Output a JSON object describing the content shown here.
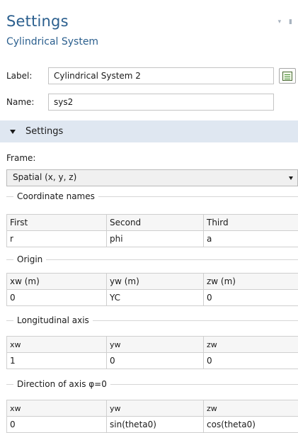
{
  "header": {
    "title": "Settings",
    "subtitle": "Cylindrical System"
  },
  "fields": {
    "label_caption": "Label:",
    "label_value": "Cylindrical System 2",
    "name_caption": "Name:",
    "name_value": "sys2"
  },
  "section": {
    "label": "Settings",
    "expanded": true
  },
  "frame": {
    "caption": "Frame:",
    "selected": "Spatial  (x, y, z)"
  },
  "groups": [
    {
      "title": "Coordinate names",
      "headers": [
        "First",
        "Second",
        "Third"
      ],
      "values": [
        "r",
        "phi",
        "a"
      ]
    },
    {
      "title": "Origin",
      "headers": [
        "xw (m)",
        "yw (m)",
        "zw (m)"
      ],
      "values": [
        "0",
        "YC",
        "0"
      ]
    },
    {
      "title": "Longitudinal axis",
      "headers": [
        "xw",
        "yw",
        "zw"
      ],
      "values": [
        "1",
        "0",
        "0"
      ]
    },
    {
      "title": "Direction of axis φ=0",
      "headers": [
        "xw",
        "yw",
        "zw"
      ],
      "values": [
        "0",
        "sin(theta0)",
        "cos(theta0)"
      ]
    }
  ],
  "icons": {
    "copy": "copy-label-icon",
    "window": "window-controls-icon"
  },
  "colors": {
    "title": "#2b5f8e",
    "section_bar": "#dfe7f1"
  }
}
